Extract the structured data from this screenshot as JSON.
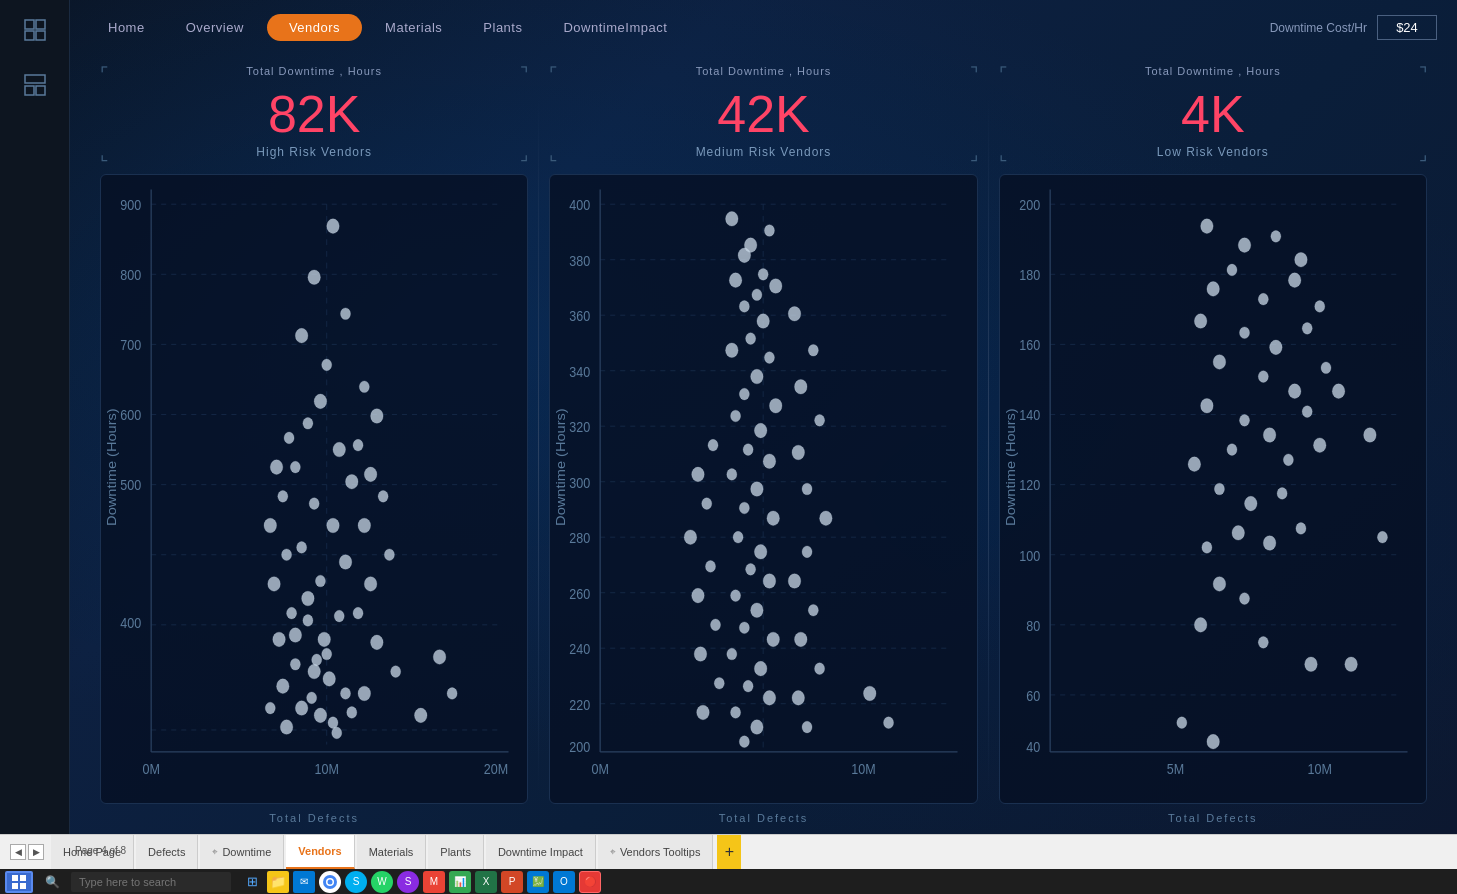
{
  "nav": {
    "items": [
      {
        "label": "Home",
        "active": false
      },
      {
        "label": "Overview",
        "active": false
      },
      {
        "label": "Vendors",
        "active": true
      },
      {
        "label": "Materials",
        "active": false
      },
      {
        "label": "Plants",
        "active": false
      },
      {
        "label": "DowntimeImpact",
        "active": false
      }
    ],
    "cost_label": "Downtime Cost/Hr",
    "cost_value": "$24"
  },
  "panels": [
    {
      "id": "high-risk",
      "total_label": "Total Downtime , Hours",
      "value": "82K",
      "risk_label": "High Risk Vendors",
      "y_axis_label": "Downtime (Hours)",
      "x_axis_label": "Total Defects",
      "y_ticks": [
        "900",
        "800",
        "700",
        "600",
        "500",
        "400"
      ],
      "x_ticks": [
        "0M",
        "10M",
        "20M"
      ]
    },
    {
      "id": "medium-risk",
      "total_label": "Total Downtime , Hours",
      "value": "42K",
      "risk_label": "Medium Risk Vendors",
      "y_axis_label": "Downtime (Hours)",
      "x_axis_label": "Total Defects",
      "y_ticks": [
        "400",
        "380",
        "360",
        "340",
        "320",
        "300",
        "280",
        "260",
        "240",
        "220",
        "200"
      ],
      "x_ticks": [
        "0M",
        "10M"
      ]
    },
    {
      "id": "low-risk",
      "total_label": "Total Downtime , Hours",
      "value": "4K",
      "risk_label": "Low Risk Vendors",
      "y_axis_label": "Downtime (Hours)",
      "x_axis_label": "Total Defects",
      "y_ticks": [
        "200",
        "180",
        "160",
        "140",
        "120",
        "100",
        "80",
        "60",
        "40"
      ],
      "x_ticks": [
        "5M",
        "10M"
      ]
    }
  ],
  "sheet_tabs": [
    {
      "label": "Home Page",
      "active": false,
      "has_icon": false
    },
    {
      "label": "Defects",
      "active": false,
      "has_icon": false
    },
    {
      "label": "Downtime",
      "active": false,
      "has_icon": true
    },
    {
      "label": "Vendors",
      "active": true,
      "has_icon": false
    },
    {
      "label": "Materials",
      "active": false,
      "has_icon": false
    },
    {
      "label": "Plants",
      "active": false,
      "has_icon": false
    },
    {
      "label": "Downtime Impact",
      "active": false,
      "has_icon": false
    },
    {
      "label": "Vendors Tooltips",
      "active": false,
      "has_icon": true
    }
  ],
  "page_info": "Page 4 of 8",
  "taskbar": {
    "search_placeholder": "Type here to search",
    "app_icons": [
      "⊞",
      "🔍",
      "⊡",
      "📁",
      "✉",
      "🌐",
      "S",
      "W",
      "S",
      "M",
      "📊",
      "💹",
      "📋",
      "O",
      "🔴"
    ]
  },
  "sidebar_icons": [
    "⊞",
    "⊟"
  ]
}
